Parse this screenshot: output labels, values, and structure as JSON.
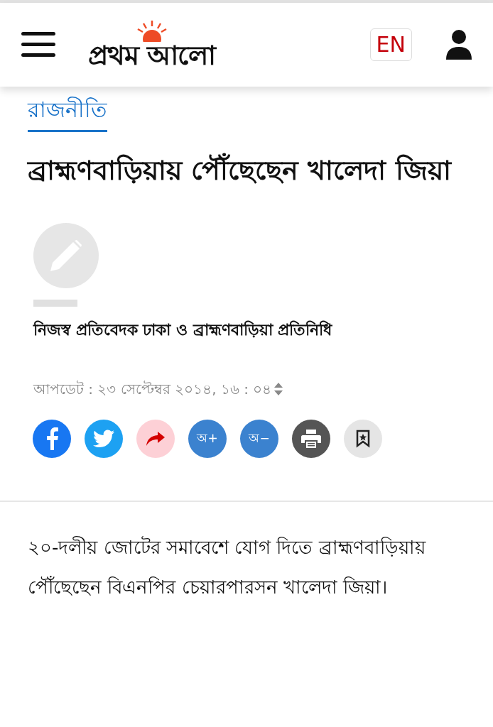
{
  "header": {
    "logo_text": "প্রথম আলো",
    "language_button": "EN"
  },
  "category": "রাজনীতি",
  "headline": "ব্রাহ্মণবাড়িয়ায় পৌঁছেছেন খালেদা জিয়া",
  "author": "নিজস্ব প্রতিবেদক ঢাকা ও ব্রাহ্মণবাড়িয়া প্রতিনিধি",
  "updated": "আপডেট : ২৩ সেপ্টেম্বর ২০১৪, ১৬ : ০৪",
  "actions": [
    {
      "kind": "facebook"
    },
    {
      "kind": "twitter"
    },
    {
      "kind": "share"
    },
    {
      "kind": "font",
      "label": "অ+"
    },
    {
      "kind": "font",
      "label": "অ−"
    },
    {
      "kind": "print"
    },
    {
      "kind": "bookmark"
    }
  ],
  "body": "২০-দলীয় জোটের সমাবেশে যোগ দিতে ব্রাহ্মণবাড়িয়ায় পৌঁছেছেন বিএনপির চেয়ারপারসন খালেদা জিয়া।"
}
